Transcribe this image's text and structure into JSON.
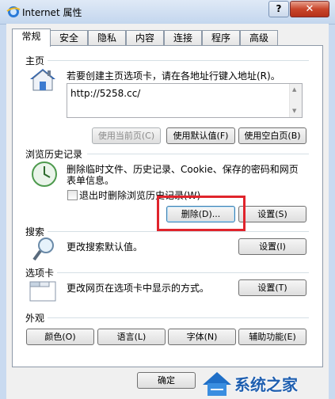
{
  "window": {
    "title": "Internet 属性",
    "help_label": "?",
    "close_label": "✕"
  },
  "tabs": [
    "常规",
    "安全",
    "隐私",
    "内容",
    "连接",
    "程序",
    "高级"
  ],
  "home": {
    "section_label": "主页",
    "description": "若要创建主页选项卡，请在各地址行键入地址(R)。",
    "url": "http://5258.cc/",
    "btn_current": "使用当前页(C)",
    "btn_default": "使用默认值(F)",
    "btn_blank": "使用空白页(B)"
  },
  "history": {
    "section_label": "浏览历史记录",
    "description_line1": "删除临时文件、历史记录、Cookie、保存的密码和网页",
    "description_line2": "表单信息。",
    "checkbox_label": "退出时删除浏览历史记录(W)",
    "btn_delete": "删除(D)...",
    "btn_settings": "设置(S)"
  },
  "search": {
    "section_label": "搜索",
    "description": "更改搜索默认值。",
    "btn_settings": "设置(I)"
  },
  "tabs_section": {
    "section_label": "选项卡",
    "description": "更改网页在选项卡中显示的方式。",
    "btn_settings": "设置(T)"
  },
  "appearance": {
    "section_label": "外观",
    "btn_colors": "颜色(O)",
    "btn_languages": "语言(L)",
    "btn_fonts": "字体(N)",
    "btn_accessibility": "辅助功能(E)"
  },
  "footer": {
    "btn_ok": "确定"
  },
  "watermark": {
    "text": "系统之家"
  },
  "colors": {
    "highlight_box": "#e0242c",
    "accent": "#3c7fb1"
  }
}
